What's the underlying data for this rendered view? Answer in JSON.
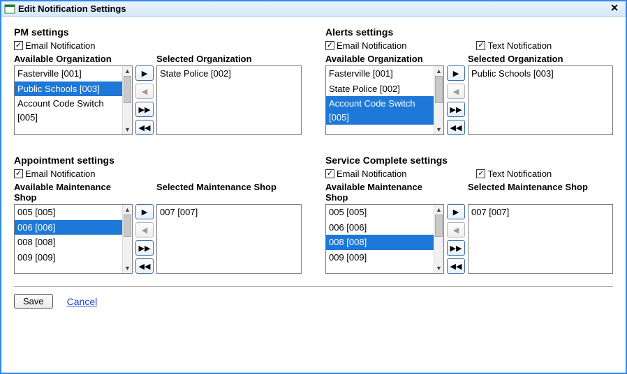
{
  "window": {
    "title": "Edit Notification Settings",
    "close_glyph": "✕"
  },
  "labels": {
    "avail_org": "Available Organization",
    "sel_org": "Selected Organization",
    "avail_shop": "Available Maintenance Shop",
    "sel_shop": "Selected Maintenance Shop",
    "email_notif": "Email Notification",
    "text_notif": "Text Notification"
  },
  "mover_glyphs": {
    "add": "▶",
    "remove": "◀",
    "add_all": "▶▶",
    "remove_all": "◀◀"
  },
  "sections": {
    "pm": {
      "title": "PM settings",
      "email_checked": true,
      "available": [
        {
          "label": "Fasterville [001]",
          "selected": false
        },
        {
          "label": "Public Schools [003]",
          "selected": true
        },
        {
          "label": "Account Code Switch [005]",
          "selected": false
        }
      ],
      "selected_list": [
        {
          "label": "State Police [002]"
        }
      ]
    },
    "alerts": {
      "title": "Alerts settings",
      "email_checked": true,
      "text_checked": true,
      "available": [
        {
          "label": "Fasterville [001]",
          "selected": false
        },
        {
          "label": "State Police [002]",
          "selected": false
        },
        {
          "label": "Account Code Switch [005]",
          "selected": true
        }
      ],
      "selected_list": [
        {
          "label": "Public Schools [003]"
        }
      ]
    },
    "appointment": {
      "title": "Appointment settings",
      "email_checked": true,
      "available": [
        {
          "label": "005 [005]",
          "selected": false
        },
        {
          "label": "006 [006]",
          "selected": true
        },
        {
          "label": "008 [008]",
          "selected": false
        },
        {
          "label": "009 [009]",
          "selected": false
        }
      ],
      "selected_list": [
        {
          "label": "007 [007]"
        }
      ]
    },
    "service": {
      "title": "Service Complete settings",
      "email_checked": true,
      "text_checked": true,
      "available": [
        {
          "label": "005 [005]",
          "selected": false
        },
        {
          "label": "006 [006]",
          "selected": false
        },
        {
          "label": "008 [008]",
          "selected": true
        },
        {
          "label": "009 [009]",
          "selected": false
        }
      ],
      "selected_list": [
        {
          "label": "007 [007]"
        }
      ]
    }
  },
  "footer": {
    "save": "Save",
    "cancel": "Cancel"
  }
}
